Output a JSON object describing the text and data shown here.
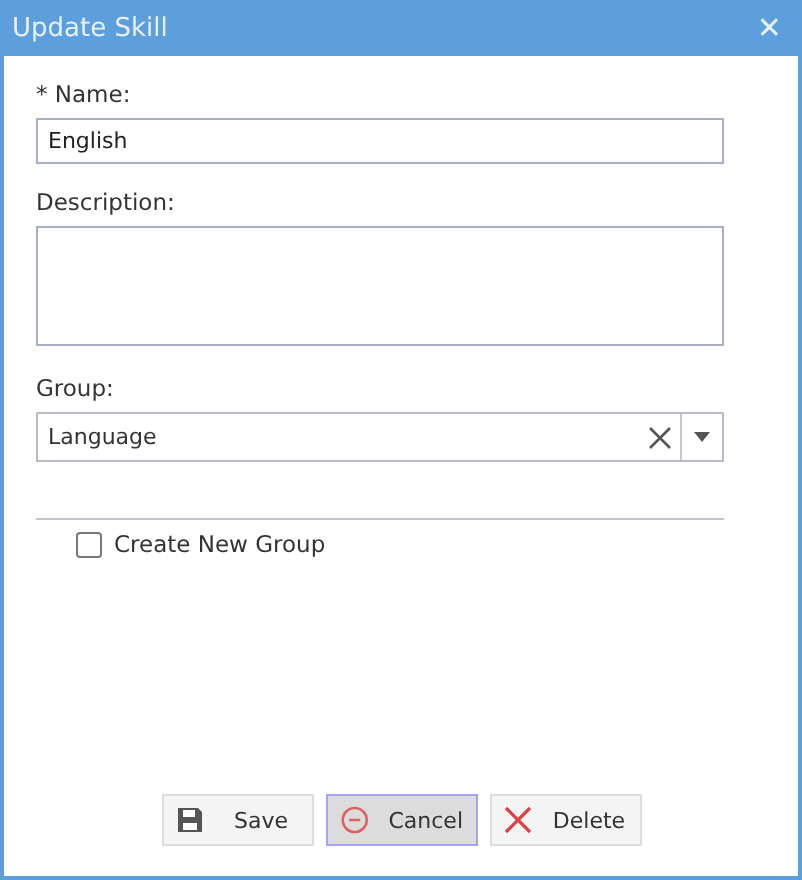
{
  "window": {
    "title": "Update Skill",
    "close": "✕"
  },
  "name_field": {
    "label": "* Name:",
    "value": "English"
  },
  "description_field": {
    "label": "Description:"
  },
  "group_field": {
    "label": "Group:",
    "value": "Language"
  },
  "create_new_group": {
    "label": "Create New Group",
    "checked": false
  },
  "buttons": [
    {
      "kind": "save",
      "label": "Save",
      "focused": false
    },
    {
      "kind": "cancel",
      "label": "Cancel",
      "focused": true
    },
    {
      "kind": "delete",
      "label": "Delete",
      "focused": false
    }
  ]
}
